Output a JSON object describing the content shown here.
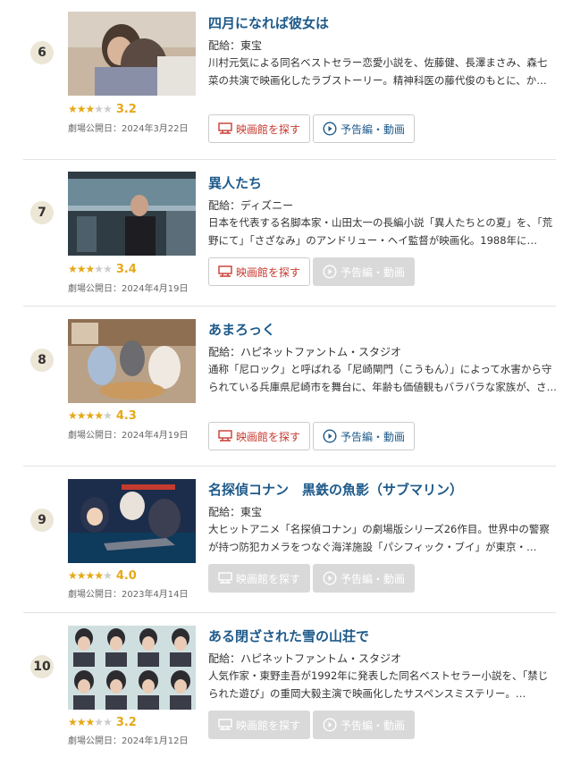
{
  "colors": {
    "title": "#1e5a8a",
    "star": "#e6a817",
    "theater_btn": "#c83c32",
    "trailer_btn": "#1e5a8a",
    "disabled_btn": "#d9d9d9"
  },
  "items": [
    {
      "rank": "6",
      "title": "四月になれば彼女は",
      "distributor": "配給：東宝",
      "description": "川村元気による同名ベストセラー恋愛小説を、佐藤健、長澤まさみ、森七菜の共演で映画化したラブストーリー。精神科医の藤代俊のもとに、か…",
      "rating": 3.2,
      "rating_label": "3.2",
      "release": "劇場公開日：2024年3月22日",
      "theater_btn": "映画館を探す",
      "trailer_btn": "予告編・動画",
      "theater_enabled": true,
      "trailer_enabled": true
    },
    {
      "rank": "7",
      "title": "異人たち",
      "distributor": "配給：ディズニー",
      "description": "日本を代表する名脚本家・山田太一の長編小説「異人たちとの夏」を、「荒野にて」「さざなみ」のアンドリュー・ヘイ監督が映画化。1988年に…",
      "rating": 3.4,
      "rating_label": "3.4",
      "release": "劇場公開日：2024年4月19日",
      "theater_btn": "映画館を探す",
      "trailer_btn": "予告編・動画",
      "theater_enabled": true,
      "trailer_enabled": false
    },
    {
      "rank": "8",
      "title": "あまろっく",
      "distributor": "配給：ハピネットファントム・スタジオ",
      "description": "通称「尼ロック」と呼ばれる「尼崎閘門（こうもん）」によって水害から守られている兵庫県尼崎市を舞台に、年齢も価値観もバラバラな家族が、さ…",
      "rating": 4.3,
      "rating_label": "4.3",
      "release": "劇場公開日：2024年4月19日",
      "theater_btn": "映画館を探す",
      "trailer_btn": "予告編・動画",
      "theater_enabled": true,
      "trailer_enabled": true
    },
    {
      "rank": "9",
      "title": "名探偵コナン　黒鉄の魚影（サブマリン）",
      "distributor": "配給：東宝",
      "description": "大ヒットアニメ「名探偵コナン」の劇場版シリーズ26作目。世界中の警察が持つ防犯カメラをつなぐ海洋施設「パシフィック・ブイ」が東京・…",
      "rating": 4.0,
      "rating_label": "4.0",
      "release": "劇場公開日：2023年4月14日",
      "theater_btn": "映画館を探す",
      "trailer_btn": "予告編・動画",
      "theater_enabled": false,
      "trailer_enabled": false
    },
    {
      "rank": "10",
      "title": "ある閉ざされた雪の山荘で",
      "distributor": "配給：ハピネットファントム・スタジオ",
      "description": "人気作家・東野圭吾が1992年に発表した同名ベストセラー小説を、「禁じられた遊び」の重岡大毅主演で映画化したサスペンスミステリー。…",
      "rating": 3.2,
      "rating_label": "3.2",
      "release": "劇場公開日：2024年1月12日",
      "theater_btn": "映画館を探す",
      "trailer_btn": "予告編・動画",
      "theater_enabled": false,
      "trailer_enabled": false
    }
  ]
}
